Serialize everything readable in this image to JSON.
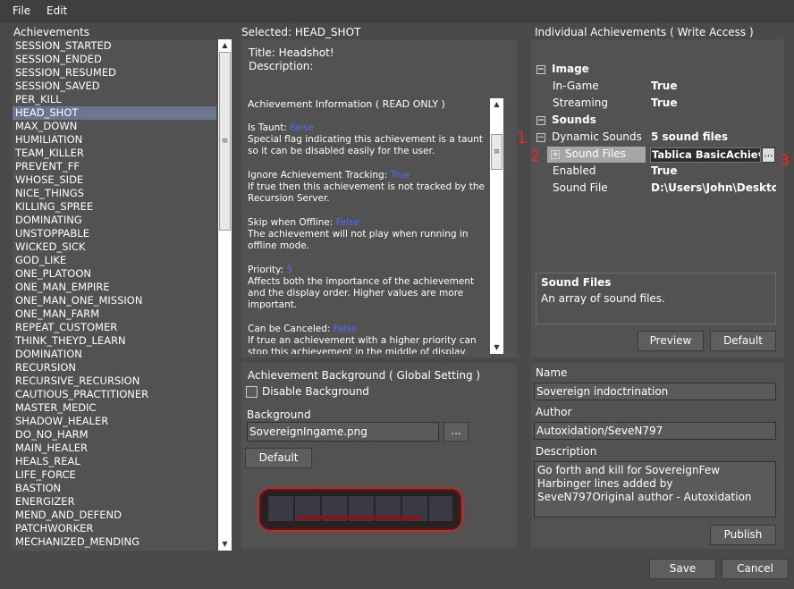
{
  "menu": {
    "file": "File",
    "edit": "Edit"
  },
  "achievements": {
    "header": "Achievements",
    "items": [
      "SESSION_STARTED",
      "SESSION_ENDED",
      "SESSION_RESUMED",
      "SESSION_SAVED",
      "PER_KILL",
      "HEAD_SHOT",
      "MAX_DOWN",
      "HUMILIATION",
      "TEAM_KILLER",
      "PREVENT_FF",
      "WHOSE_SIDE",
      "NICE_THINGS",
      "KILLING_SPREE",
      "DOMINATING",
      "UNSTOPPABLE",
      "WICKED_SICK",
      "GOD_LIKE",
      "ONE_PLATOON",
      "ONE_MAN_EMPIRE",
      "ONE_MAN_ONE_MISSION",
      "ONE_MAN_FARM",
      "REPEAT_CUSTOMER",
      "THINK_THEYD_LEARN",
      "DOMINATION",
      "RECURSION",
      "RECURSIVE_RECURSION",
      "CAUTIOUS_PRACTITIONER",
      "MASTER_MEDIC",
      "SHADOW_HEALER",
      "DO_NO_HARM",
      "MAIN_HEALER",
      "HEALS_REAL",
      "LIFE_FORCE",
      "BASTION",
      "ENERGIZER",
      "MEND_AND_DEFEND",
      "PATCHWORKER",
      "MECHANIZED_MENDING"
    ],
    "selected_index": 5
  },
  "selected": {
    "header": "Selected: HEAD_SHOT",
    "title": "Title: Headshot!",
    "description": "Description:"
  },
  "info": {
    "heading": "Achievement Information ( READ ONLY )",
    "entries": [
      {
        "label": "Is Taunt: ",
        "value": "False",
        "desc": [
          "Special flag indicating this achievement is a taunt",
          "so it can be disabled easily for the user."
        ]
      },
      {
        "label": "Ignore Achievement Tracking: ",
        "value": "True",
        "desc": [
          "If true then this achievement is not tracked by the",
          "Recursion Server."
        ]
      },
      {
        "label": "Skip when Offline: ",
        "value": "False",
        "desc": [
          "The achievement will not play when running in",
          "offline mode."
        ]
      },
      {
        "label": "Priority: ",
        "value": "5",
        "desc": [
          "Affects both the importance of the achievement",
          "and the display order. Higher values are more",
          "important."
        ]
      },
      {
        "label": "Can be Canceled: ",
        "value": "False",
        "desc": [
          "If true an achievement with a higher priority can",
          "stop this achievement in the middle of display."
        ]
      }
    ]
  },
  "background": {
    "header": "Achievement Background ( Global Setting )",
    "disable_label": "Disable Background",
    "bg_label": "Background",
    "bg_value": "SovereignIngame.png",
    "browse": "...",
    "default": "Default"
  },
  "individual": {
    "header": "Individual Achievements ( Write Access )",
    "props": {
      "image_cat": "Image",
      "ingame_label": "In-Game",
      "ingame_val": "True",
      "streaming_label": "Streaming",
      "streaming_val": "True",
      "sounds_cat": "Sounds",
      "dyn_label": "Dynamic Sounds",
      "dyn_val": "5 sound files",
      "sf_label": "Sound Files",
      "sf_val": "Tablica BasicAchievem",
      "enabled_label": "Enabled",
      "enabled_val": "True",
      "sfile_label": "Sound File",
      "sfile_val": "D:\\Users\\John\\Desktop\\S"
    },
    "help_title": "Sound Files",
    "help_text": "An array of sound files.",
    "preview": "Preview",
    "default": "Default"
  },
  "annotations": {
    "n1": "1",
    "n2": "2",
    "n3": "3"
  },
  "meta": {
    "name_label": "Name",
    "name_value": "Sovereign indoctrination",
    "author_label": "Author",
    "author_value": "Autoxidation/SeveN797",
    "desc_label": "Description",
    "desc_value": "Go forth and kill for SovereignFew Harbinger lines added by SeveN797Original author - Autoxidation",
    "publish": "Publish"
  },
  "footer": {
    "save": "Save",
    "cancel": "Cancel"
  }
}
